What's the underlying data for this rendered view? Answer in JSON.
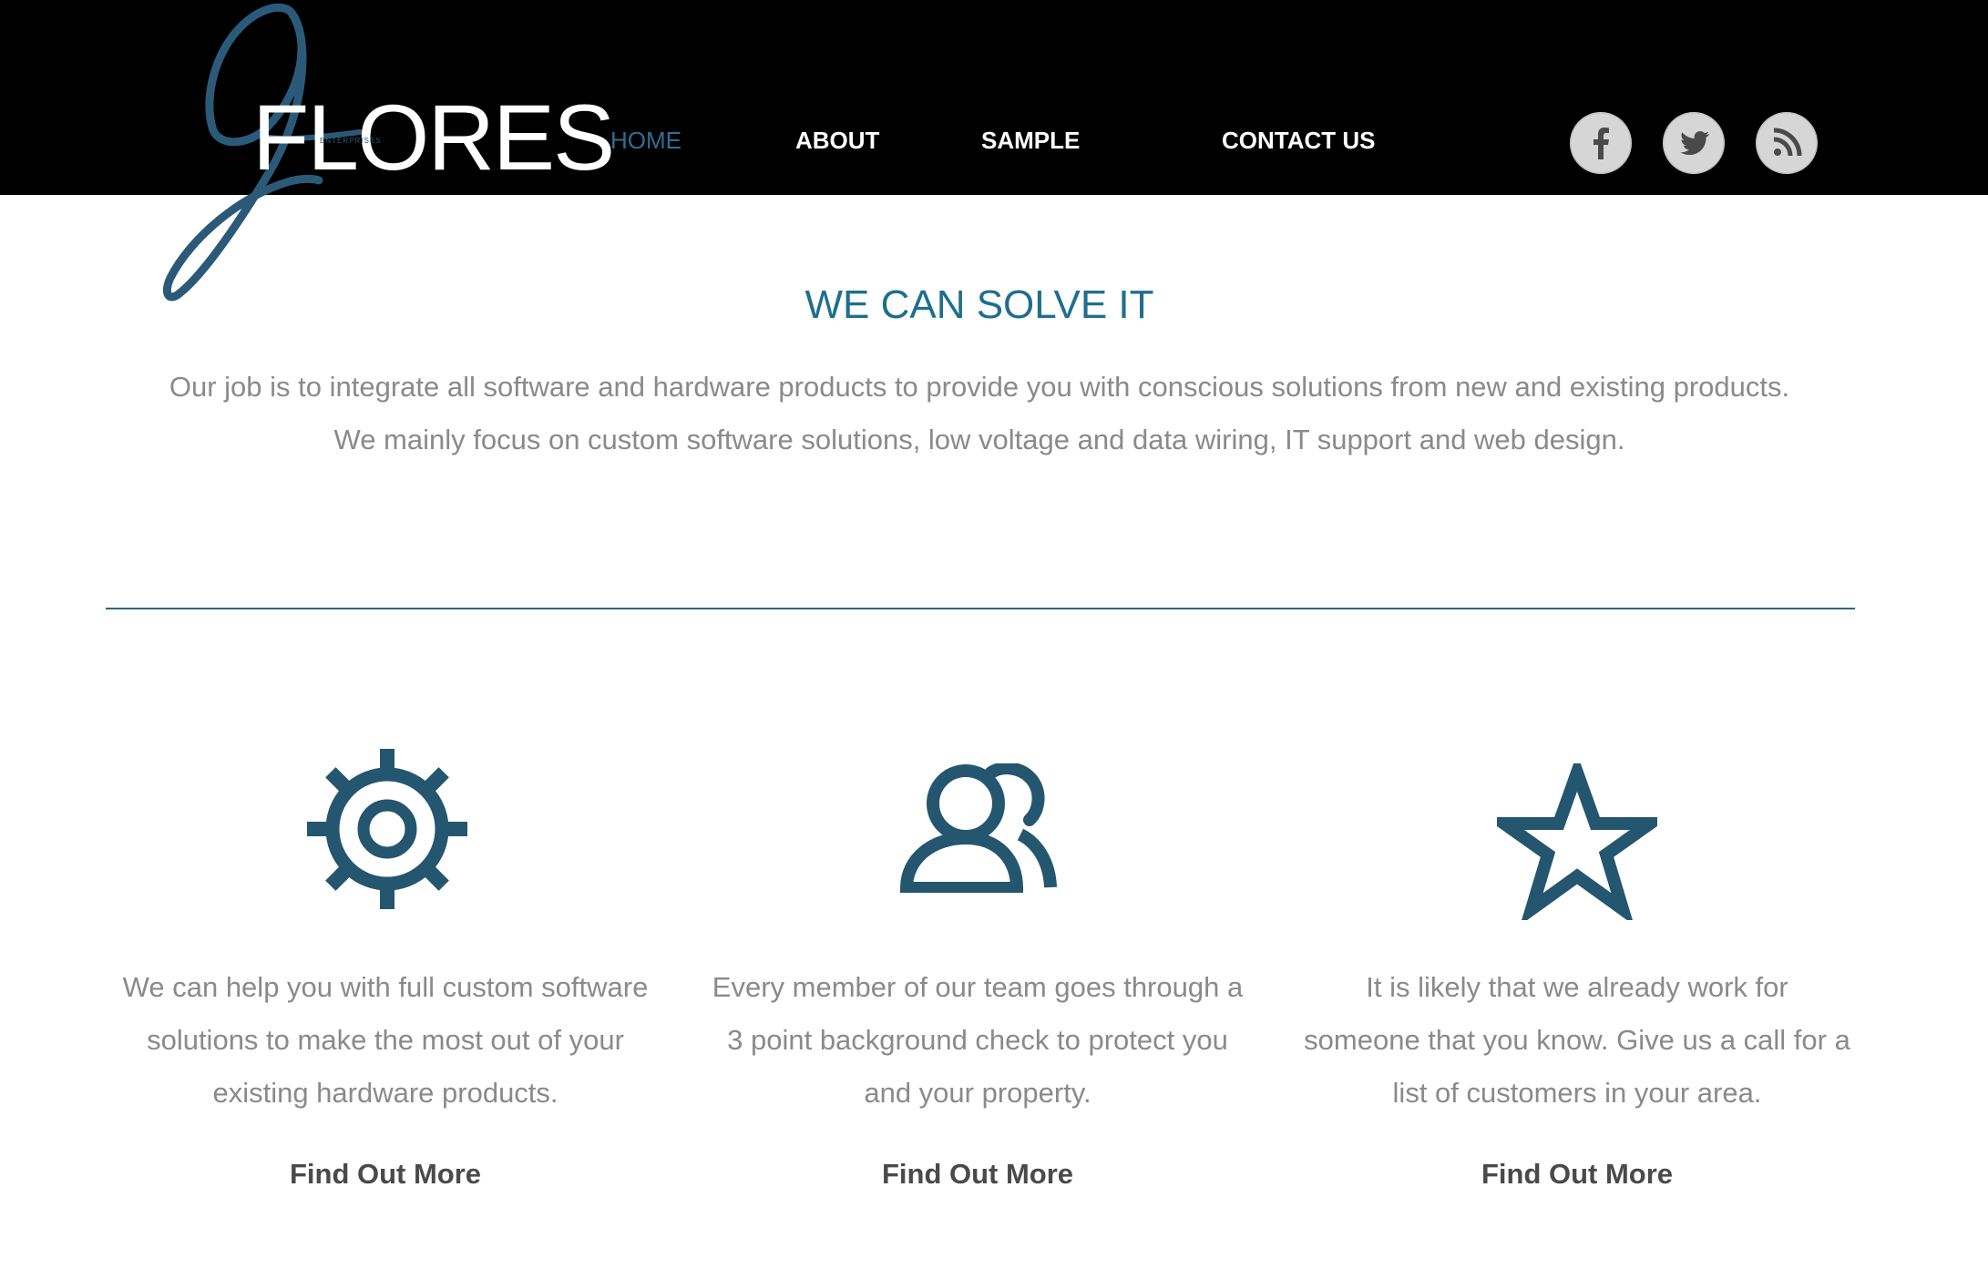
{
  "header": {
    "logo_text": "FLORES",
    "logo_subtext": "ENTERPRISES",
    "nav": [
      {
        "label": "HOME",
        "active": true
      },
      {
        "label": "ABOUT",
        "active": false
      },
      {
        "label": "SAMPLE",
        "active": false
      },
      {
        "label": "CONTACT US",
        "active": false
      }
    ],
    "social": [
      {
        "icon": "facebook-icon"
      },
      {
        "icon": "twitter-icon"
      },
      {
        "icon": "rss-icon"
      }
    ]
  },
  "hero": {
    "title": "WE CAN SOLVE IT",
    "lines": [
      "Our job is to integrate all software and hardware products to provide you with conscious solutions from new and existing products.",
      "We mainly focus on custom software solutions, low voltage and data wiring, IT support and web design."
    ]
  },
  "features": [
    {
      "icon": "gear-icon",
      "lines": [
        "We can help you with full custom software",
        "solutions to make the most out of your",
        "existing hardware products."
      ],
      "link": "Find Out More"
    },
    {
      "icon": "users-icon",
      "lines": [
        "Every member of our team goes through a",
        "3 point background check to protect you",
        "and your property."
      ],
      "link": "Find Out More"
    },
    {
      "icon": "star-icon",
      "lines": [
        "It is likely that we already work for",
        "someone that you know. Give us a call for a",
        "list of customers in your area."
      ],
      "link": "Find Out More"
    }
  ],
  "colors": {
    "header_bg": "#000000",
    "accent": "#1f6e90",
    "icon": "#24566f",
    "body_text": "#8a8a8a",
    "link_text": "#4a4a4a"
  }
}
